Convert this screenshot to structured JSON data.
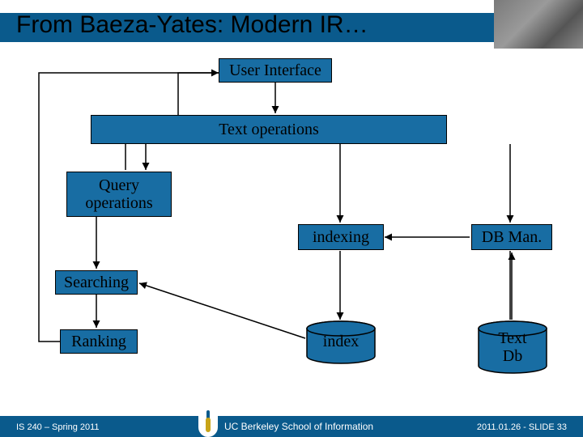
{
  "title": "From Baeza-Yates: Modern IR…",
  "nodes": {
    "user_interface": "User Interface",
    "text_operations": "Text operations",
    "query_operations": "Query\noperations",
    "indexing": "indexing",
    "db_man": "DB Man.",
    "searching": "Searching",
    "index": "index",
    "ranking": "Ranking",
    "text_db": "Text\nDb"
  },
  "footer": {
    "left": "IS 240 – Spring 2011",
    "logo_text": "UC Berkeley School of Information",
    "right": "2011.01.26 - SLIDE 33"
  }
}
